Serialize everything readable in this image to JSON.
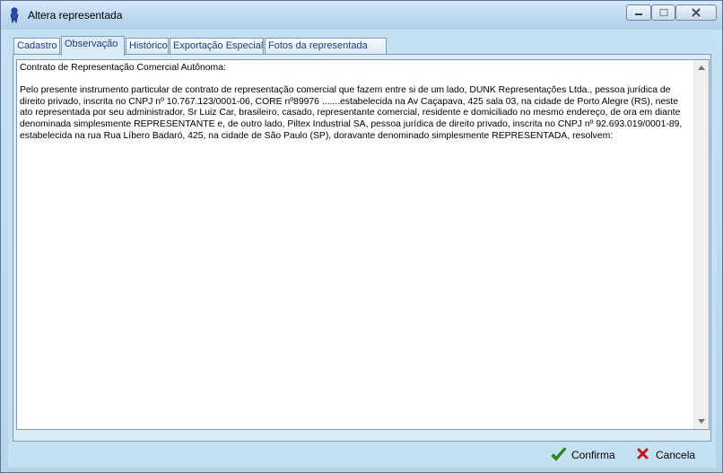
{
  "window": {
    "title": "Altera representada"
  },
  "tabs": [
    {
      "label": "Cadastro",
      "active": false
    },
    {
      "label": "Observação",
      "active": true
    },
    {
      "label": "Histórico",
      "active": false
    },
    {
      "label": "Exportação Especial",
      "active": false
    },
    {
      "label": "Fotos da representada",
      "active": false
    }
  ],
  "memo": {
    "heading": "Contrato de Representação Comercial Autônoma:",
    "body": "Pelo presente instrumento particular de contrato de representação comercial que fazem entre si de um lado, DUNK Representações Ltda., pessoa jurídica de direito privado, inscrita no CNPJ nº 10.767.123/0001-06, CORE nº89976 .......estabelecida na Av Caçapava, 425 sala 03, na cidade de Porto Alegre (RS), neste ato representada por seu administrador, Sr Luiz Car, brasileiro, casado, representante comercial, residente e domiciliado no mesmo endereço, de ora em diante denominada simplesmente REPRESENTANTE e, de outro lado, Piltex Industrial SA, pessoa jurídica de direito privado, inscrita no CNPJ nº 92.693.019/0001-89, estabelecida na rua Rua Líbero Badaró, 425, na cidade de São Paulo (SP), doravante denominado simplesmente REPRESENTADA, resolvem:"
  },
  "footer": {
    "confirm_label": "Confirma",
    "cancel_label": "Cancela"
  },
  "colors": {
    "confirm_icon": "#2f9a1a",
    "cancel_icon": "#c0171a",
    "tab_text": "#1b3d8a"
  },
  "icons": {
    "app": "ribbon-person-icon",
    "minimize": "minimize-icon",
    "maximize": "maximize-icon",
    "close": "close-icon",
    "confirm": "checkmark-icon",
    "cancel": "x-icon"
  }
}
